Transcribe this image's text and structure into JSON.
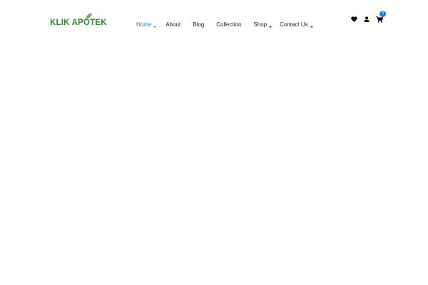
{
  "brand": {
    "name": "KLIK APOTEK",
    "color": "#2f8a2f"
  },
  "nav": {
    "active_color": "#1e7ad6",
    "items": [
      {
        "label": "Home"
      },
      {
        "label": "About"
      },
      {
        "label": "Blog"
      },
      {
        "label": "Collection"
      },
      {
        "label": "Shop"
      },
      {
        "label": "Contact Us"
      }
    ]
  },
  "header_icons": {
    "wishlist": "heart-icon",
    "account": "user-icon",
    "cart": "cart-icon",
    "cart_count": "0"
  }
}
